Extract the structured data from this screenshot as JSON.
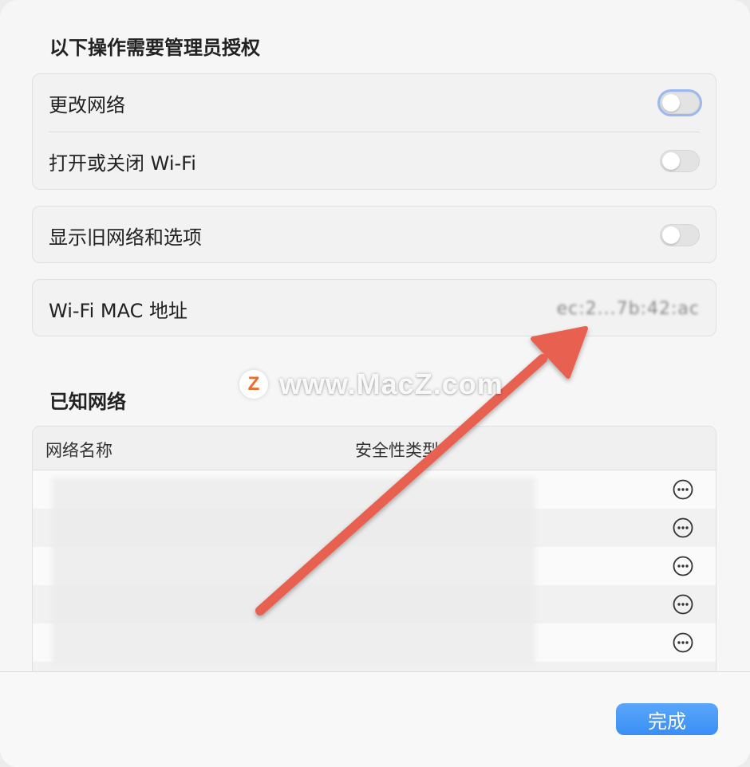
{
  "admin": {
    "title": "以下操作需要管理员授权",
    "rows": [
      {
        "label": "更改网络",
        "enabled": false
      },
      {
        "label": "打开或关闭 Wi-Fi",
        "enabled": false
      }
    ]
  },
  "legacy": {
    "label": "显示旧网络和选项",
    "enabled": false
  },
  "mac": {
    "label": "Wi-Fi MAC 地址",
    "value": "ec:2...7b:42:ac"
  },
  "known": {
    "title": "已知网络",
    "columns": [
      "网络名称",
      "安全性类型"
    ]
  },
  "footer": {
    "done_label": "完成"
  },
  "watermark": {
    "logo": "Z",
    "text": "www.MacZ.com"
  },
  "colors": {
    "accent": "#3a8ef5",
    "arrow": "#e8604f"
  }
}
